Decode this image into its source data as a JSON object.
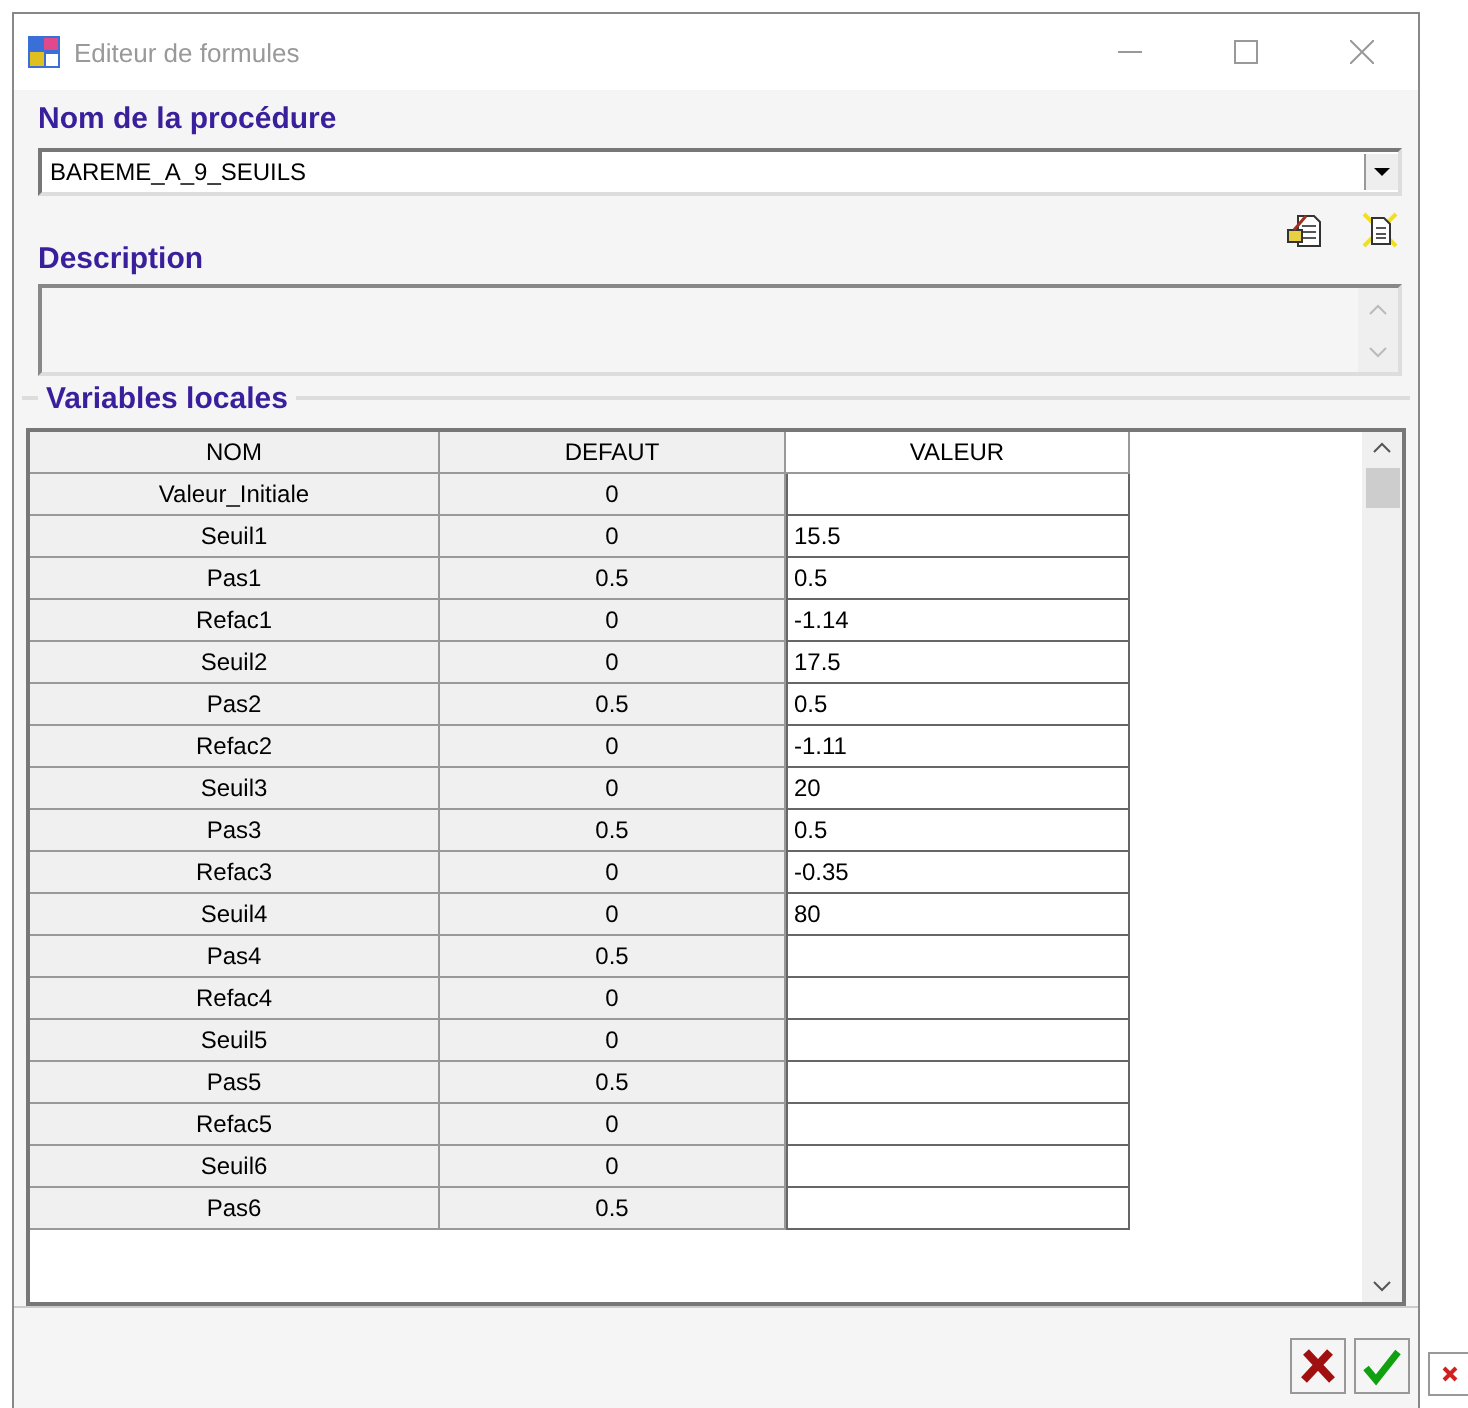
{
  "window": {
    "title": "Editeur de formules"
  },
  "procedure": {
    "label": "Nom de la procédure",
    "value": "BAREME_A_9_SEUILS"
  },
  "description": {
    "label": "Description"
  },
  "variables": {
    "label": "Variables locales",
    "columns": [
      "NOM",
      "DEFAUT",
      "VALEUR"
    ],
    "rows": [
      {
        "nom": "Valeur_Initiale",
        "defaut": "0",
        "valeur": ""
      },
      {
        "nom": "Seuil1",
        "defaut": "0",
        "valeur": "15.5"
      },
      {
        "nom": "Pas1",
        "defaut": "0.5",
        "valeur": "0.5"
      },
      {
        "nom": "Refac1",
        "defaut": "0",
        "valeur": "-1.14"
      },
      {
        "nom": "Seuil2",
        "defaut": "0",
        "valeur": "17.5"
      },
      {
        "nom": "Pas2",
        "defaut": "0.5",
        "valeur": "0.5"
      },
      {
        "nom": "Refac2",
        "defaut": "0",
        "valeur": "-1.11"
      },
      {
        "nom": "Seuil3",
        "defaut": "0",
        "valeur": "20"
      },
      {
        "nom": "Pas3",
        "defaut": "0.5",
        "valeur": "0.5"
      },
      {
        "nom": "Refac3",
        "defaut": "0",
        "valeur": "-0.35"
      },
      {
        "nom": "Seuil4",
        "defaut": "0",
        "valeur": "80"
      },
      {
        "nom": "Pas4",
        "defaut": "0.5",
        "valeur": ""
      },
      {
        "nom": "Refac4",
        "defaut": "0",
        "valeur": ""
      },
      {
        "nom": "Seuil5",
        "defaut": "0",
        "valeur": ""
      },
      {
        "nom": "Pas5",
        "defaut": "0.5",
        "valeur": ""
      },
      {
        "nom": "Refac5",
        "defaut": "0",
        "valeur": ""
      },
      {
        "nom": "Seuil6",
        "defaut": "0",
        "valeur": ""
      },
      {
        "nom": "Pas6",
        "defaut": "0.5",
        "valeur": ""
      }
    ]
  }
}
